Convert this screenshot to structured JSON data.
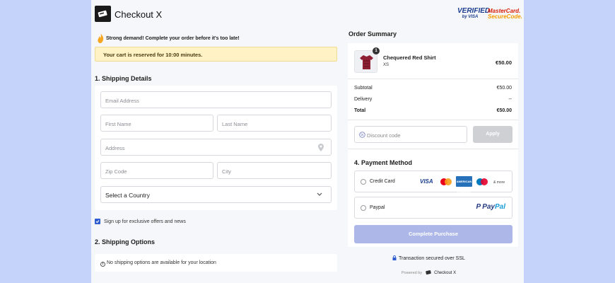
{
  "header": {
    "brand": "Checkout X",
    "badges": {
      "verified_line1": "VERIFIED",
      "verified_line2": "by VISA",
      "mc_line1": "MasterCard.",
      "mc_line2": "SecureCode."
    }
  },
  "alerts": {
    "demand": "Strong demand! Complete your order before it's too late!",
    "reserved": "Your cart is reserved for 10:00 minutes."
  },
  "shipping": {
    "title": "1. Shipping Details",
    "fields": {
      "email": "Email Address",
      "first_name": "First Name",
      "last_name": "Last Name",
      "address": "Address",
      "zip": "Zip Code",
      "city": "City",
      "country": "Select a Country"
    },
    "signup_label": "Sign up for exclusive offers and news"
  },
  "shipping_options": {
    "title": "2. Shipping Options",
    "note": "No shipping options are available for your location"
  },
  "summary": {
    "title": "Order Summary",
    "item": {
      "quantity": "1",
      "name": "Chequered Red Shirt",
      "size": "XS",
      "price": "€50.00"
    },
    "totals": {
      "subtotal_label": "Subtotal",
      "subtotal": "€50.00",
      "delivery_label": "Delivery",
      "delivery": "--",
      "total_label": "Total",
      "total": "€50.00"
    },
    "discount_placeholder": "Discount code",
    "apply_label": "Apply"
  },
  "payment": {
    "title": "4. Payment Method",
    "credit_card_label": "Credit Card",
    "visa": "VISA",
    "amex": "AMERICAN EXPRESS",
    "more": "& more",
    "paypal_label": "Paypal",
    "paypal_logo_a": "Pay",
    "paypal_logo_b": "Pal",
    "complete_label": "Complete Purchase"
  },
  "footer": {
    "ssl": "Transaction secured over SSL",
    "powered_by": "Powered by",
    "powered_brand": "Checkout X"
  },
  "colors": {
    "accent": "#2f5ccf",
    "complete_button": "#aeb8e8",
    "reserve_bg": "#fff3c5",
    "outer_bg": "#c5d3fb"
  },
  "icons": [
    "store-logo-icon",
    "flame-icon",
    "location-pin-icon",
    "chevron-down-icon",
    "checkbox-checked-icon",
    "info-icon",
    "shirt-thumbnail-icon",
    "discount-tag-icon",
    "mastercard-icon",
    "diners-icon",
    "paypal-icon",
    "lock-icon",
    "checkout-x-icon"
  ]
}
